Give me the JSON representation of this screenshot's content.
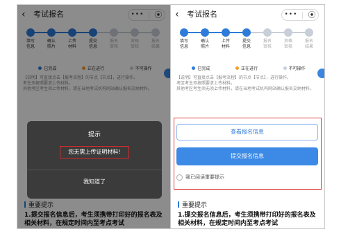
{
  "left": {
    "title": "考试报名",
    "back_icon": "‹",
    "capsule_more": "•••",
    "capsule_close": "⦿",
    "steps": [
      {
        "label_1": "填写",
        "label_2": "信息",
        "state": "done"
      },
      {
        "label_1": "确认",
        "label_2": "照片",
        "state": "done"
      },
      {
        "label_1": "上传",
        "label_2": "材料",
        "state": "done"
      },
      {
        "label_1": "提交",
        "label_2": "信息",
        "state": "done"
      },
      {
        "label_1": "报名",
        "label_2": "审核",
        "state": "todo"
      },
      {
        "label_1": "资格",
        "label_2": "审核",
        "state": "todo"
      },
      {
        "label_1": "报名",
        "label_2": "结果",
        "state": "todo"
      }
    ],
    "legend": {
      "done": "已完成",
      "doing": "正在进行",
      "disabled": "不可操作"
    },
    "note": "【说明】可直接点击【报考流程】的节点【节点】，进行操作。\n考生须按照要求上传材料，\n其他考区考生须上传材料，请在当地考试机构网站确认报名交纳材料。",
    "section_title": "重要提示",
    "body_text": "1.提交报名信息后，考生须携带打印好的报名表及相关材料，在规定时间内至考点考试",
    "dialog": {
      "title": "提示",
      "message": "您无需上传证明材料!",
      "button": "我知道了"
    }
  },
  "right": {
    "title": "考试报名",
    "back_icon": "‹",
    "capsule_more": "•••",
    "capsule_close": "⦿",
    "steps": [
      {
        "label_1": "填写",
        "label_2": "信息",
        "state": "done"
      },
      {
        "label_1": "确认",
        "label_2": "照片",
        "state": "done"
      },
      {
        "label_1": "上传",
        "label_2": "材料",
        "state": "done"
      },
      {
        "label_1": "提交",
        "label_2": "信息",
        "state": "done"
      },
      {
        "label_1": "报名",
        "label_2": "审核",
        "state": "todo"
      },
      {
        "label_1": "资格",
        "label_2": "审核",
        "state": "todo"
      },
      {
        "label_1": "报名",
        "label_2": "结果",
        "state": "todo"
      }
    ],
    "legend": {
      "done": "已完成",
      "doing": "正在进行",
      "disabled": "不可操作"
    },
    "note": "【说明】可直接点击【报考流程】的节点【节点】，进行操作。\n考区考生须按照要求上传材料，\n其他考区考生须无须上传材料，请在当地考试机构网站确认报名交纳材料。",
    "view_button": "查看报名信息",
    "submit_button": "提交报名信息",
    "agree_text": "我已阅读重要提示",
    "section_title": "重要提示",
    "body_text": "1.提交报名信息后，考生须携带打印好的报名表及相关材料，在规定时间内至考点考试"
  },
  "colors": {
    "accent": "#2f7bd9",
    "highlight_red": "#e23b3b",
    "dialog_bg": "#3b3b3b"
  }
}
